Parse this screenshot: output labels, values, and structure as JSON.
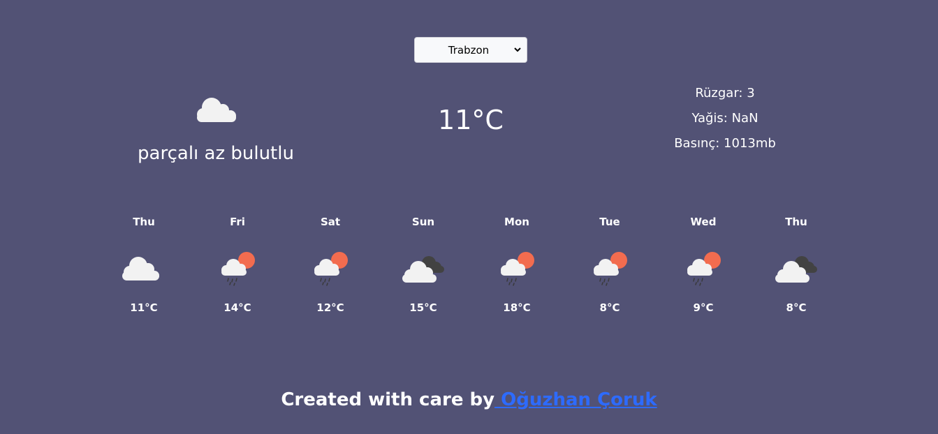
{
  "city_select": {
    "selected": "Trabzon",
    "caret_icon": "chevron-down-icon"
  },
  "current": {
    "icon": "cloud-icon",
    "description": "parçalı az bulutlu",
    "temperature": "11°C",
    "wind": "Rüzgar: 3",
    "precipitation": "Yağis: NaN",
    "pressure": "Basınç: 1013mb"
  },
  "forecast": [
    {
      "day": "Thu",
      "temp": "11°C",
      "icon": "cloud-icon"
    },
    {
      "day": "Fri",
      "temp": "14°C",
      "icon": "sun-cloud-rain-icon"
    },
    {
      "day": "Sat",
      "temp": "12°C",
      "icon": "sun-cloud-rain-icon"
    },
    {
      "day": "Sun",
      "temp": "15°C",
      "icon": "overcast-clouds-icon"
    },
    {
      "day": "Mon",
      "temp": "18°C",
      "icon": "sun-cloud-rain-icon"
    },
    {
      "day": "Tue",
      "temp": "8°C",
      "icon": "sun-cloud-rain-icon"
    },
    {
      "day": "Wed",
      "temp": "9°C",
      "icon": "sun-cloud-rain-icon"
    },
    {
      "day": "Thu",
      "temp": "8°C",
      "icon": "overcast-clouds-icon"
    }
  ],
  "footer": {
    "text": "Created with care by",
    "author": " Oğuzhan Çoruk"
  },
  "colors": {
    "background": "#525275",
    "sun": "#f26c4f",
    "cloud": "#f2f2f2",
    "dark_cloud": "#424242",
    "link": "#2d6bff"
  }
}
